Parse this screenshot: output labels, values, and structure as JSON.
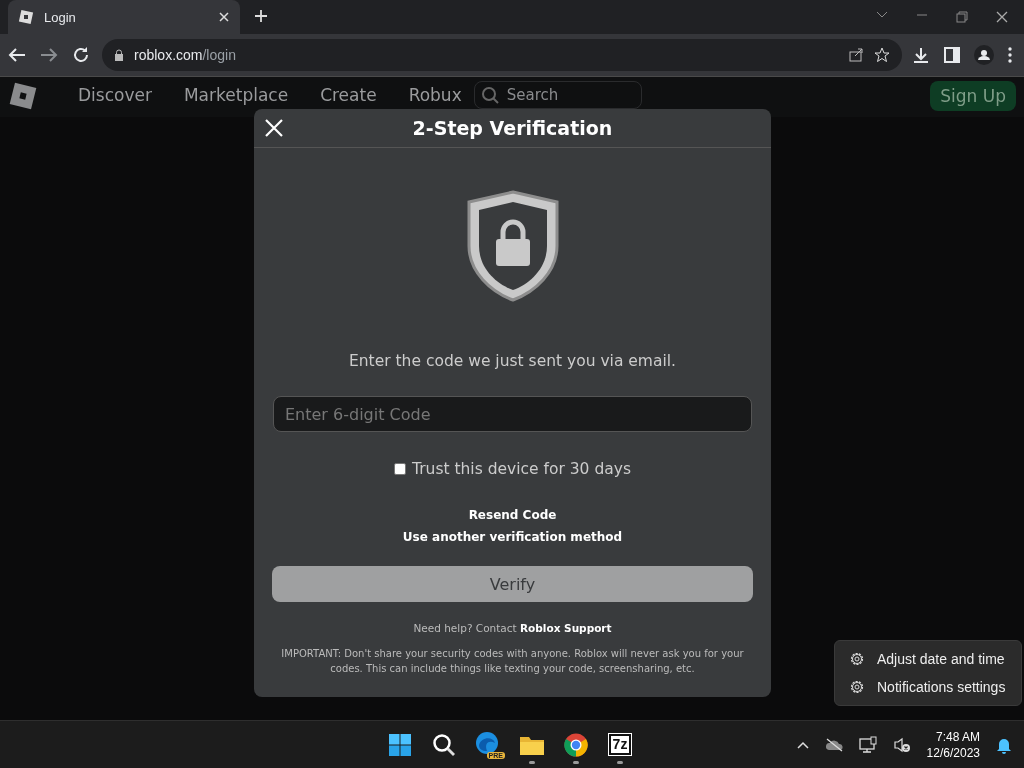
{
  "browser": {
    "tab": {
      "title": "Login"
    },
    "address": {
      "domain": "roblox.com",
      "path": "/login"
    }
  },
  "site_nav": {
    "links": [
      "Discover",
      "Marketplace",
      "Create",
      "Robux"
    ],
    "search": {
      "placeholder": "Search"
    },
    "sign_up": "Sign Up"
  },
  "dialog": {
    "title": "2-Step Verification",
    "instruction": "Enter the code we just sent you via email.",
    "code_field": {
      "placeholder": "Enter 6-digit Code"
    },
    "trust": {
      "label": "Trust this device for 30 days",
      "checked": false
    },
    "links": [
      "Resend Code",
      "Use another verification method"
    ],
    "verify_button": {
      "label": "Verify",
      "disabled": true
    },
    "help": "Need help? Contact **Roblox Support**",
    "notice": "IMPORTANT: Don't share your security codes with anyone. Roblox will never ask you for your codes. This can include things like texting your code, screensharing, etc."
  },
  "tray_menu": {
    "items": [
      "Adjust date and time",
      "Notifications settings"
    ]
  },
  "taskbar": {
    "apps": [
      {
        "kind": "start",
        "running": false
      },
      {
        "kind": "search",
        "running": false
      },
      {
        "kind": "edge",
        "badge": "PRE",
        "running": false
      },
      {
        "kind": "files",
        "running": true
      },
      {
        "kind": "chrome",
        "running": true
      },
      {
        "kind": "archiver",
        "label": "7z",
        "running": true
      }
    ],
    "clock": {
      "time": "7:48 AM",
      "date": "12/6/2023"
    }
  }
}
